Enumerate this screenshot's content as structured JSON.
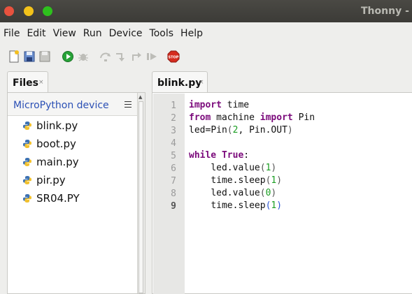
{
  "window": {
    "title": "Thonny  -  /"
  },
  "menu": [
    "File",
    "Edit",
    "View",
    "Run",
    "Device",
    "Tools",
    "Help"
  ],
  "toolbar_icons": [
    "new-file-icon",
    "open-file-icon",
    "save-file-icon",
    "run-icon",
    "debug-icon",
    "step-over-icon",
    "step-into-icon",
    "step-out-icon",
    "resume-icon",
    "stop-icon"
  ],
  "files_panel": {
    "tab_label": "Files",
    "close_glyph": "×",
    "device_label": "MicroPython device",
    "files": [
      "blink.py",
      "boot.py",
      "main.py",
      "pir.py",
      "SR04.PY"
    ]
  },
  "editor": {
    "tab_label": "blink.py",
    "close_glyph": "×",
    "line_numbers": [
      "1",
      "2",
      "3",
      "4",
      "5",
      "6",
      "7",
      "8",
      "9"
    ],
    "current_line": 9,
    "lines": [
      "import time",
      "from machine import Pin",
      "led=Pin(2, Pin.OUT)",
      "",
      "while True:",
      "    led.value(1)",
      "    time.sleep(1)",
      "    led.value(0)",
      "    time.sleep(1)"
    ]
  },
  "colors": {
    "keyword": "#7b0a7b",
    "number": "#1a9e22",
    "device_label": "#2b50b5",
    "highlight_bracket": "#2b55d4"
  }
}
